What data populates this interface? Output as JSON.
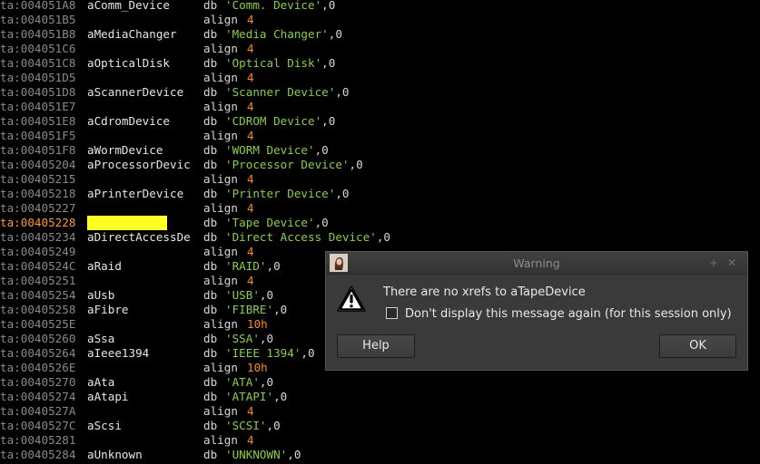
{
  "listing": [
    {
      "addr": "ta:004051A8",
      "name": "aComm_Device",
      "mnemonic": "db",
      "op": [
        {
          "t": "'Comm. Device'",
          "c": "str"
        },
        {
          "t": ",0",
          "c": "pl"
        }
      ]
    },
    {
      "addr": "ta:004051B5",
      "name": "",
      "mnemonic": "align",
      "op": [
        {
          "t": "4",
          "c": "num"
        }
      ]
    },
    {
      "addr": "ta:004051B8",
      "name": "aMediaChanger",
      "mnemonic": "db",
      "op": [
        {
          "t": "'Media Changer'",
          "c": "str"
        },
        {
          "t": ",0",
          "c": "pl"
        }
      ]
    },
    {
      "addr": "ta:004051C6",
      "name": "",
      "mnemonic": "align",
      "op": [
        {
          "t": "4",
          "c": "num"
        }
      ]
    },
    {
      "addr": "ta:004051C8",
      "name": "aOpticalDisk",
      "mnemonic": "db",
      "op": [
        {
          "t": "'Optical Disk'",
          "c": "str"
        },
        {
          "t": ",0",
          "c": "pl"
        }
      ]
    },
    {
      "addr": "ta:004051D5",
      "name": "",
      "mnemonic": "align",
      "op": [
        {
          "t": "4",
          "c": "num"
        }
      ]
    },
    {
      "addr": "ta:004051D8",
      "name": "aScannerDevice",
      "mnemonic": "db",
      "op": [
        {
          "t": "'Scanner Device'",
          "c": "str"
        },
        {
          "t": ",0",
          "c": "pl"
        }
      ]
    },
    {
      "addr": "ta:004051E7",
      "name": "",
      "mnemonic": "align",
      "op": [
        {
          "t": "4",
          "c": "num"
        }
      ]
    },
    {
      "addr": "ta:004051E8",
      "name": "aCdromDevice",
      "mnemonic": "db",
      "op": [
        {
          "t": "'CDROM Device'",
          "c": "str"
        },
        {
          "t": ",0",
          "c": "pl"
        }
      ]
    },
    {
      "addr": "ta:004051F5",
      "name": "",
      "mnemonic": "align",
      "op": [
        {
          "t": "4",
          "c": "num"
        }
      ]
    },
    {
      "addr": "ta:004051F8",
      "name": "aWormDevice",
      "mnemonic": "db",
      "op": [
        {
          "t": "'WORM Device'",
          "c": "str"
        },
        {
          "t": ",0",
          "c": "pl"
        }
      ]
    },
    {
      "addr": "ta:00405204",
      "name": "aProcessorDevic",
      "mnemonic": "db",
      "op": [
        {
          "t": "'Processor Device'",
          "c": "str"
        },
        {
          "t": ",0",
          "c": "pl"
        }
      ]
    },
    {
      "addr": "ta:00405215",
      "name": "",
      "mnemonic": "align",
      "op": [
        {
          "t": "4",
          "c": "num"
        }
      ]
    },
    {
      "addr": "ta:00405218",
      "name": "aPrinterDevice",
      "mnemonic": "db",
      "op": [
        {
          "t": "'Printer Device'",
          "c": "str"
        },
        {
          "t": ",0",
          "c": "pl"
        }
      ]
    },
    {
      "addr": "ta:00405227",
      "name": "",
      "mnemonic": "align",
      "op": [
        {
          "t": "4",
          "c": "num"
        }
      ]
    },
    {
      "addr": "ta:00405228",
      "name": "",
      "mnemonic": "db",
      "op": [
        {
          "t": "'Tape Device'",
          "c": "str"
        },
        {
          "t": ",0",
          "c": "pl"
        }
      ],
      "current": true
    },
    {
      "addr": "ta:00405234",
      "name": "aDirectAccessDe",
      "mnemonic": "db",
      "op": [
        {
          "t": "'Direct Access Device'",
          "c": "str"
        },
        {
          "t": ",0",
          "c": "pl"
        }
      ]
    },
    {
      "addr": "ta:00405249",
      "name": "",
      "mnemonic": "align",
      "op": [
        {
          "t": "4",
          "c": "num"
        }
      ]
    },
    {
      "addr": "ta:0040524C",
      "name": "aRaid",
      "mnemonic": "db",
      "op": [
        {
          "t": "'RAID'",
          "c": "str"
        },
        {
          "t": ",0",
          "c": "pl"
        }
      ]
    },
    {
      "addr": "ta:00405251",
      "name": "",
      "mnemonic": "align",
      "op": [
        {
          "t": "4",
          "c": "num"
        }
      ]
    },
    {
      "addr": "ta:00405254",
      "name": "aUsb",
      "mnemonic": "db",
      "op": [
        {
          "t": "'USB'",
          "c": "str"
        },
        {
          "t": ",0",
          "c": "pl"
        }
      ]
    },
    {
      "addr": "ta:00405258",
      "name": "aFibre",
      "mnemonic": "db",
      "op": [
        {
          "t": "'FIBRE'",
          "c": "str"
        },
        {
          "t": ",0",
          "c": "pl"
        }
      ]
    },
    {
      "addr": "ta:0040525E",
      "name": "",
      "mnemonic": "align",
      "op": [
        {
          "t": "10h",
          "c": "num"
        }
      ]
    },
    {
      "addr": "ta:00405260",
      "name": "aSsa",
      "mnemonic": "db",
      "op": [
        {
          "t": "'SSA'",
          "c": "str"
        },
        {
          "t": ",0",
          "c": "pl"
        }
      ]
    },
    {
      "addr": "ta:00405264",
      "name": "aIeee1394",
      "mnemonic": "db",
      "op": [
        {
          "t": "'IEEE 1394'",
          "c": "str"
        },
        {
          "t": ",0",
          "c": "pl"
        }
      ]
    },
    {
      "addr": "ta:0040526E",
      "name": "",
      "mnemonic": "align",
      "op": [
        {
          "t": "10h",
          "c": "num"
        }
      ]
    },
    {
      "addr": "ta:00405270",
      "name": "aAta",
      "mnemonic": "db",
      "op": [
        {
          "t": "'ATA'",
          "c": "str"
        },
        {
          "t": ",0",
          "c": "pl"
        }
      ]
    },
    {
      "addr": "ta:00405274",
      "name": "aAtapi",
      "mnemonic": "db",
      "op": [
        {
          "t": "'ATAPI'",
          "c": "str"
        },
        {
          "t": ",0",
          "c": "pl"
        }
      ]
    },
    {
      "addr": "ta:0040527A",
      "name": "",
      "mnemonic": "align",
      "op": [
        {
          "t": "4",
          "c": "num"
        }
      ]
    },
    {
      "addr": "ta:0040527C",
      "name": "aScsi",
      "mnemonic": "db",
      "op": [
        {
          "t": "'SCSI'",
          "c": "str"
        },
        {
          "t": ",0",
          "c": "pl"
        }
      ]
    },
    {
      "addr": "ta:00405281",
      "name": "",
      "mnemonic": "align",
      "op": [
        {
          "t": "4",
          "c": "num"
        }
      ]
    },
    {
      "addr": "ta:00405284",
      "name": "aUnknown",
      "mnemonic": "db",
      "op": [
        {
          "t": "'UNKNOWN'",
          "c": "str"
        },
        {
          "t": ",0",
          "c": "pl"
        }
      ]
    }
  ],
  "colors": {
    "address": "#8a8a8a",
    "current_address": "#ff9c1a",
    "string": "#89d13a",
    "number": "#ff8a1a",
    "highlight": "#ffff22"
  },
  "dialog": {
    "title": "Warning",
    "icon": "warning-triangle-icon",
    "message": "There are no xrefs to aTapeDevice",
    "checkbox_label": "Don't display this message again (for this session only)",
    "checkbox_checked": false,
    "help_label": "Help",
    "ok_label": "OK"
  }
}
